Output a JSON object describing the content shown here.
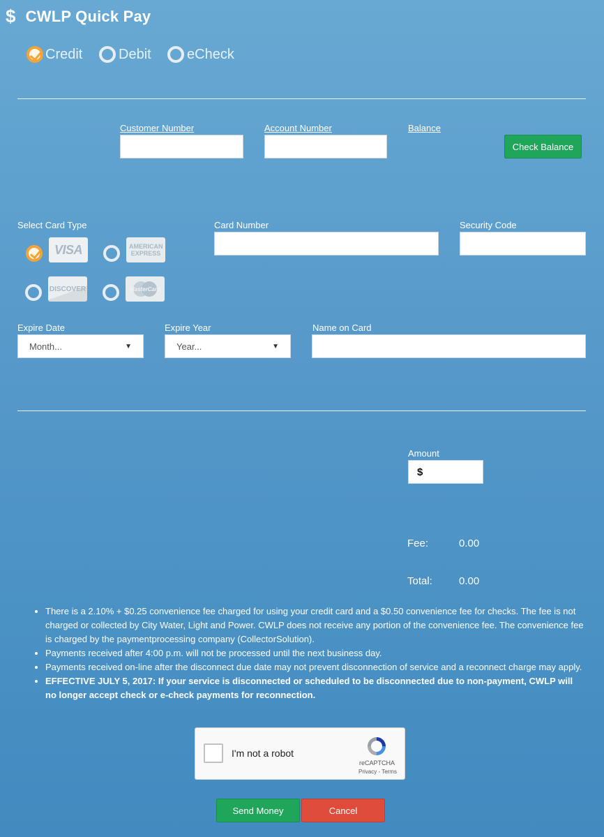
{
  "header": {
    "icon": "dollar-icon",
    "dollar_glyph": "$",
    "title": "CWLP Quick Pay"
  },
  "payment_methods": [
    {
      "label": "Credit",
      "selected": true
    },
    {
      "label": "Debit",
      "selected": false
    },
    {
      "label": "eCheck",
      "selected": false
    }
  ],
  "account": {
    "customer_number_label": "Customer Number",
    "account_number_label": "Account Number",
    "balance_label": "Balance",
    "check_balance_button": "Check Balance"
  },
  "card": {
    "select_card_type_label": "Select Card Type",
    "types": [
      {
        "name": "VISA",
        "selected": true
      },
      {
        "name": "AMERICAN EXPRESS",
        "selected": false
      },
      {
        "name": "DISCOVER",
        "selected": false
      },
      {
        "name": "MasterCard",
        "selected": false
      }
    ],
    "card_number_label": "Card Number",
    "security_code_label": "Security Code",
    "expire_date_label": "Expire Date",
    "expire_date_value": "Month...",
    "expire_year_label": "Expire Year",
    "expire_year_value": "Year...",
    "name_on_card_label": "Name on Card"
  },
  "amount": {
    "label": "Amount",
    "prefix": "$"
  },
  "totals": {
    "fee_label": "Fee:",
    "fee_value": "0.00",
    "total_label": "Total:",
    "total_value": "0.00"
  },
  "notes": [
    "There is a 2.10% + $0.25 convenience fee charged for using your credit card and a $0.50 convenience fee for checks. The fee is not charged or collected by City Water, Light and Power. CWLP does not receive any portion of the convenience fee. The convenience fee is charged by the paymentprocessing company (CollectorSolution).",
    "Payments received after 4:00 p.m. will not be processed until the next business day.",
    "Payments received on-line after the disconnect due date may not prevent disconnection of service and a reconnect charge may apply.",
    "EFFECTIVE JULY 5, 2017: If your service is disconnected or scheduled to be disconnected due to non-payment, CWLP will no longer accept check or e-check payments for reconnection."
  ],
  "captcha": {
    "label": "I'm not a robot",
    "brand": "reCAPTCHA",
    "links": "Privacy - Terms"
  },
  "actions": {
    "send_label": "Send Money",
    "cancel_label": "Cancel"
  },
  "colors": {
    "green": "#1fa65a",
    "red": "#e04c3b",
    "accent": "#f2a43a"
  }
}
